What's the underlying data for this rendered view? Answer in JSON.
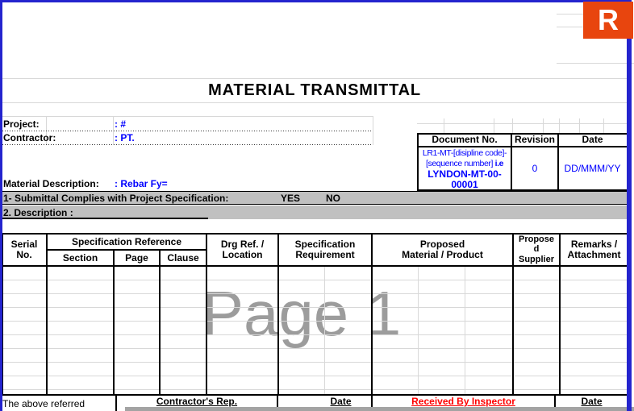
{
  "logo": {
    "letter": "R"
  },
  "title": "MATERIAL TRANSMITTAL",
  "watermark": "Page 1",
  "fields": {
    "project_label": "Project:",
    "project_value": ": #",
    "contractor_label": "Contractor:",
    "contractor_value": ": PT.",
    "material_label": "Material Description:",
    "material_value": ": Rebar Fy="
  },
  "doc_table": {
    "header_doc": "Document No.",
    "header_rev": "Revision",
    "header_date": "Date",
    "doc_no_line1": "LR1-MT-[disipline code]-",
    "doc_no_line2a": "[sequence number] ",
    "doc_no_line2b": "i.e",
    "doc_no_line3": "LYNDON-MT-00-",
    "doc_no_line4": "00001",
    "revision_value": "0",
    "date_value": "DD/MMM/YY"
  },
  "notes": {
    "item1": "1- Submittal Complies with Project Specification:",
    "yes": "YES",
    "no": "NO",
    "item2": "2. Description :"
  },
  "grid_headers": {
    "serial1": "Serial",
    "serial2": "No.",
    "spec_ref": "Specification Reference",
    "section": "Section",
    "page": "Page",
    "clause": "Clause",
    "drg1": "Drg Ref. /",
    "drg2": "Location",
    "req1": "Specification",
    "req2": "Requirement",
    "prop1": "Proposed",
    "prop2": "Material / Product",
    "sup1": "Propose",
    "sup2": "d",
    "sup3": "Supplier",
    "rem1": "Remarks /",
    "rem2": "Attachment"
  },
  "footer": {
    "note": "The above referred",
    "contractor_rep": "Contractor's Rep.",
    "date1": "Date",
    "received": "Received By Inspector",
    "date2": "Date"
  },
  "colors": {
    "page_border": "#2424CE",
    "logo_bg": "#E8450E",
    "accent_text": "#0000FF",
    "alert_text": "#FF0000",
    "section_bar": "#C0C0C0",
    "watermark_gray": "#9C9C9C",
    "gridline_gray": "#D8D8D8"
  }
}
